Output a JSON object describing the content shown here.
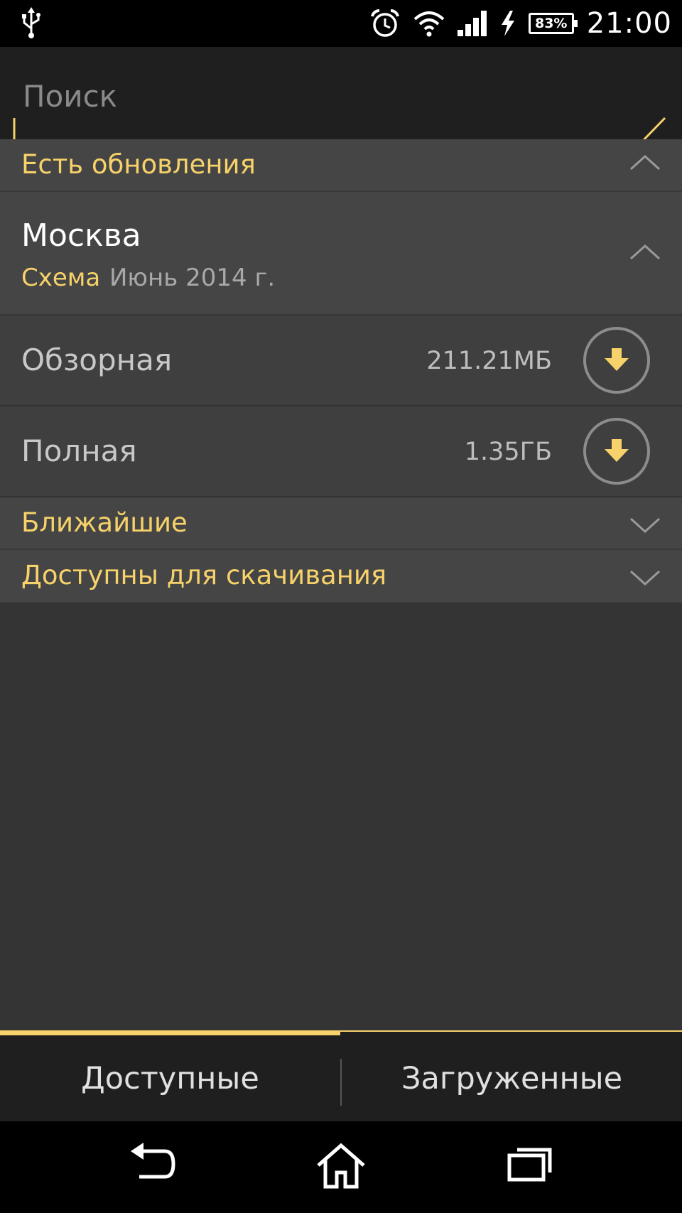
{
  "status_bar": {
    "battery_percent": "83%",
    "time": "21:00",
    "icons": [
      "usb-icon",
      "alarm-icon",
      "wifi-icon",
      "signal-icon",
      "charging-icon",
      "battery-icon"
    ]
  },
  "search": {
    "placeholder": "Поиск",
    "value": ""
  },
  "sections": {
    "updates": {
      "title": "Есть обновления"
    },
    "nearby": {
      "title": "Ближайшие"
    },
    "available_download": {
      "title": "Доступны для скачивания"
    }
  },
  "city": {
    "name": "Москва",
    "type_label": "Схема",
    "date": "Июнь 2014 г."
  },
  "maps": [
    {
      "name": "Обзорная",
      "size": "211.21МБ"
    },
    {
      "name": "Полная",
      "size": "1.35ГБ"
    }
  ],
  "tabs": {
    "available": "Доступные",
    "downloaded": "Загруженные"
  },
  "colors": {
    "accent": "#f7d26a",
    "background": "#343434",
    "section_bg": "#454545",
    "row_bg": "#3f3f3f"
  }
}
